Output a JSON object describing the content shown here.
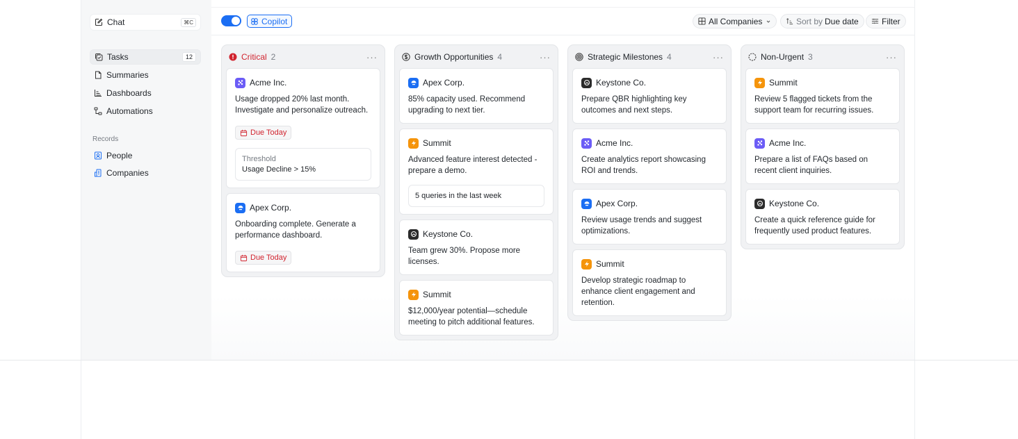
{
  "sidebar": {
    "chat": {
      "label": "Chat",
      "shortcut": "⌘C"
    },
    "nav": [
      {
        "label": "Tasks",
        "badge": "12",
        "icon": "tasks-icon"
      },
      {
        "label": "Summaries",
        "icon": "document-icon"
      },
      {
        "label": "Dashboards",
        "icon": "bar-chart-icon"
      },
      {
        "label": "Automations",
        "icon": "workflow-icon"
      }
    ],
    "records_label": "Records",
    "records": [
      {
        "label": "People",
        "icon": "contact-icon"
      },
      {
        "label": "Companies",
        "icon": "building-icon"
      }
    ]
  },
  "toolbar": {
    "copilot_label": "Copilot",
    "copilot_on": true,
    "companies_filter": "All Companies",
    "sort_prefix": "Sort by",
    "sort_value": "Due date",
    "filter_label": "Filter"
  },
  "colors": {
    "accent": "#1b6ef3",
    "critical": "#d1242f",
    "acme": "#6b5cf6",
    "apex": "#1b6ef3",
    "summit": "#f5940b",
    "keystone": "#2b2b2b"
  },
  "columns": [
    {
      "title": "Critical",
      "count": "2",
      "icon": "alert-icon",
      "cards": [
        {
          "company": "Acme Inc.",
          "text": "Usage dropped 20% last month. Investigate and personalize outreach.",
          "due": "Due Today",
          "sub_label": "Threshold",
          "sub_value": "Usage Decline > 15%"
        },
        {
          "company": "Apex Corp.",
          "text": "Onboarding complete. Generate a performance dashboard.",
          "due": "Due Today"
        }
      ]
    },
    {
      "title": "Growth Opportunities",
      "count": "4",
      "icon": "dollar-icon",
      "cards": [
        {
          "company": "Apex Corp.",
          "text": "85% capacity used. Recommend upgrading to next tier."
        },
        {
          "company": "Summit",
          "text": "Advanced feature interest detected - prepare a demo.",
          "sub_value": "5 queries in the last week"
        },
        {
          "company": "Keystone Co.",
          "text": "Team grew 30%. Propose more licenses."
        },
        {
          "company": "Summit",
          "text": "$12,000/year potential—schedule meeting to pitch additional features."
        }
      ]
    },
    {
      "title": "Strategic Milestones",
      "count": "4",
      "icon": "target-icon",
      "cards": [
        {
          "company": "Keystone Co.",
          "text": "Prepare QBR highlighting key outcomes and next steps."
        },
        {
          "company": "Acme Inc.",
          "text": "Create analytics report showcasing ROI and trends."
        },
        {
          "company": "Apex Corp.",
          "text": "Review usage trends and suggest optimizations."
        },
        {
          "company": "Summit",
          "text": "Develop strategic roadmap to enhance client engagement and retention."
        }
      ]
    },
    {
      "title": "Non-Urgent",
      "count": "3",
      "icon": "dashed-circle-icon",
      "cards": [
        {
          "company": "Summit",
          "text": "Review 5 flagged tickets from the support team for recurring issues."
        },
        {
          "company": "Acme Inc.",
          "text": "Prepare a list of FAQs based on recent client inquiries."
        },
        {
          "company": "Keystone Co.",
          "text": "Create a quick reference guide for frequently used product features."
        }
      ]
    }
  ]
}
